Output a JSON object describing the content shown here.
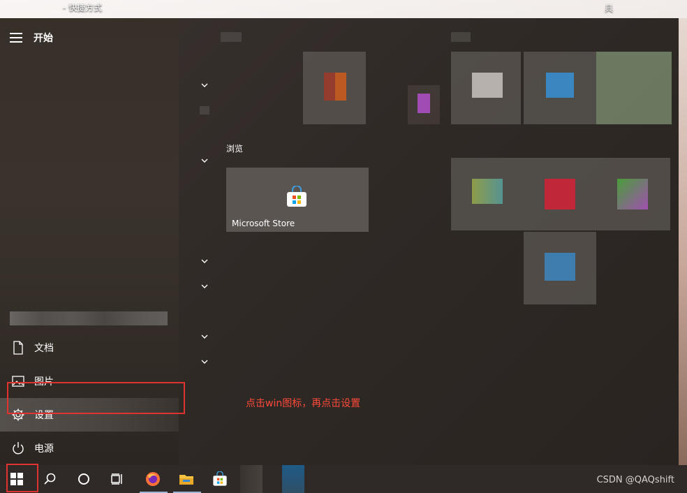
{
  "desktop": {
    "shortcut_label": "- 快捷方式",
    "right_label": "具"
  },
  "start_menu": {
    "title": "开始",
    "group_label": "浏览",
    "store_tile_label": "Microsoft Store",
    "nav": [
      {
        "label": "文档",
        "icon": "document-icon"
      },
      {
        "label": "图片",
        "icon": "pictures-icon"
      },
      {
        "label": "设置",
        "icon": "gear-icon"
      },
      {
        "label": "电源",
        "icon": "power-icon"
      }
    ]
  },
  "annotation": "点击win图标，再点击设置",
  "taskbar": {
    "items": [
      "windows-start-icon",
      "search-icon",
      "cortana-icon",
      "task-view-icon",
      "firefox-icon",
      "file-explorer-icon",
      "store-icon"
    ]
  },
  "watermark": "CSDN @QAQshift",
  "colors": {
    "highlight_red": "#e0322e",
    "annotation_red": "#ff4a3a",
    "start_bg": "#2f2926",
    "taskbar_bg": "#2f2a27"
  }
}
